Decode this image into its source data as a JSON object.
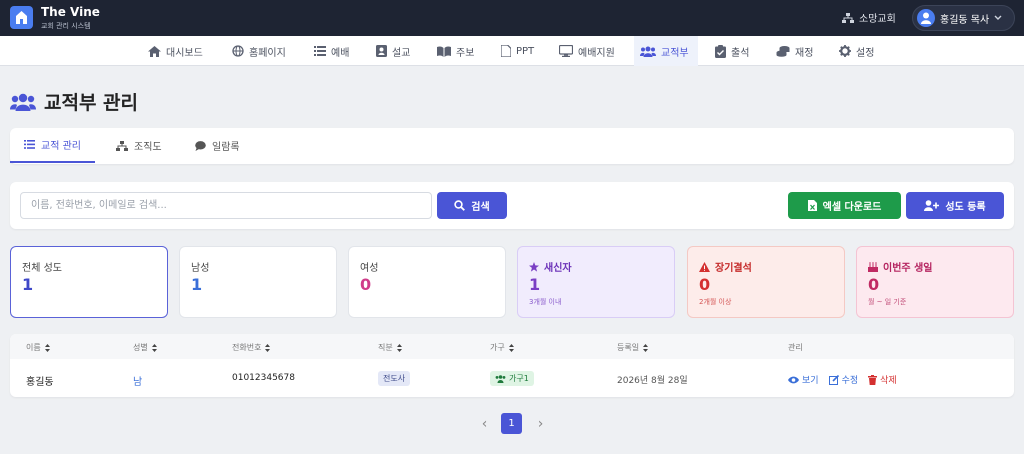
{
  "header": {
    "brand_title": "The Vine",
    "brand_subtitle": "교회 관리 시스템",
    "church_name": "소망교회",
    "user_name": "홍길동 목사"
  },
  "nav": [
    {
      "label": "대시보드",
      "icon": "home-icon"
    },
    {
      "label": "홈페이지",
      "icon": "globe-icon"
    },
    {
      "label": "예배",
      "icon": "list-icon"
    },
    {
      "label": "설교",
      "icon": "book-user-icon"
    },
    {
      "label": "주보",
      "icon": "open-book-icon"
    },
    {
      "label": "PPT",
      "icon": "file-icon"
    },
    {
      "label": "예배지원",
      "icon": "monitor-icon"
    },
    {
      "label": "교적부",
      "icon": "users-icon",
      "active": true
    },
    {
      "label": "출석",
      "icon": "clipboard-check-icon"
    },
    {
      "label": "재정",
      "icon": "coins-icon"
    },
    {
      "label": "설정",
      "icon": "gear-icon"
    }
  ],
  "page": {
    "title": "교적부 관리"
  },
  "tabs": [
    {
      "label": "교적 관리",
      "icon": "list-icon",
      "active": true
    },
    {
      "label": "조직도",
      "icon": "sitemap-icon"
    },
    {
      "label": "일람록",
      "icon": "comment-icon"
    }
  ],
  "toolbar": {
    "search_placeholder": "이름, 전화번호, 이메일로 검색...",
    "search_label": "검색",
    "excel_label": "엑셀 다운로드",
    "add_label": "성도 등록"
  },
  "stats": [
    {
      "label": "전체 성도",
      "value": "1",
      "sub": ""
    },
    {
      "label": "남성",
      "value": "1",
      "sub": ""
    },
    {
      "label": "여성",
      "value": "0",
      "sub": ""
    },
    {
      "label": "새신자",
      "value": "1",
      "sub": "3개월 이내",
      "icon": "star-icon"
    },
    {
      "label": "장기결석",
      "value": "0",
      "sub": "2개월 이상",
      "icon": "warning-icon"
    },
    {
      "label": "이번주 생일",
      "value": "0",
      "sub": "월 ~ 일 기준",
      "icon": "cake-icon"
    }
  ],
  "table": {
    "columns": [
      "이름",
      "성별",
      "전화번호",
      "직분",
      "가구",
      "등록일",
      "관리"
    ],
    "rows": [
      {
        "name": "홍길동",
        "gender": "남",
        "phone": "01012345678",
        "position": "전도사",
        "household": "가구1",
        "registered": "2026년 8월 28일"
      }
    ],
    "actions": {
      "view": "보기",
      "edit": "수정",
      "delete": "삭제"
    }
  },
  "pagination": {
    "prev": "‹",
    "current": "1",
    "next": "›"
  },
  "colors": {
    "accent": "#4a55d6",
    "excel": "#1e9b4a",
    "topbar": "#1e2433",
    "newcomer": "#7a3fc4",
    "absent": "#d43030",
    "birthday": "#c02a63"
  }
}
